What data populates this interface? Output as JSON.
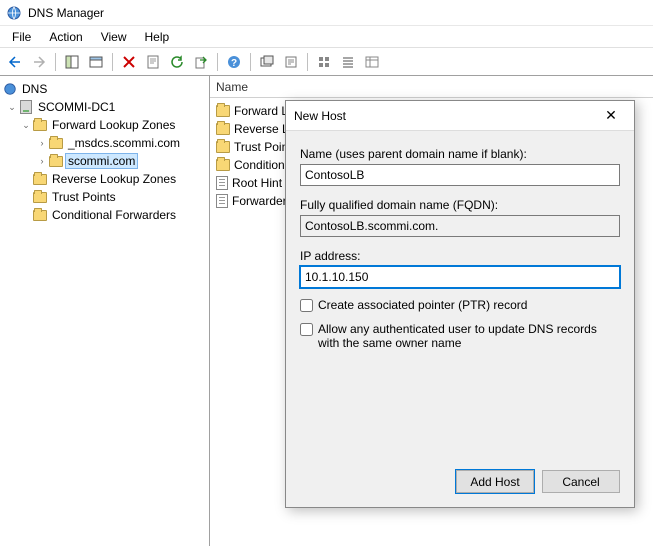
{
  "window": {
    "title": "DNS Manager"
  },
  "menu": {
    "file": "File",
    "action": "Action",
    "view": "View",
    "help": "Help"
  },
  "tree": {
    "root": "DNS",
    "server": "SCOMMI-DC1",
    "fwd_zones": "Forward Lookup Zones",
    "zone_msdcs": "_msdcs.scommi.com",
    "zone_scommi": "scommi.com",
    "rev_zones": "Reverse Lookup Zones",
    "trust_points": "Trust Points",
    "cond_fwd": "Conditional Forwarders"
  },
  "list": {
    "col_name": "Name",
    "items": {
      "forward": "Forward L",
      "reverse": "Reverse L",
      "trust": "Trust Poin",
      "cond": "Condition",
      "root": "Root Hint",
      "fwdr": "Forwarder"
    }
  },
  "dialog": {
    "title": "New Host",
    "name_label": "Name (uses parent domain name if blank):",
    "name_value": "ContosoLB",
    "fqdn_label": "Fully qualified domain name (FQDN):",
    "fqdn_value": "ContosoLB.scommi.com.",
    "ip_label": "IP address:",
    "ip_value": "10.1.10.150",
    "chk_ptr": "Create associated pointer (PTR) record",
    "chk_allow": "Allow any authenticated user to update DNS records with the same owner name",
    "btn_add": "Add Host",
    "btn_cancel": "Cancel"
  }
}
